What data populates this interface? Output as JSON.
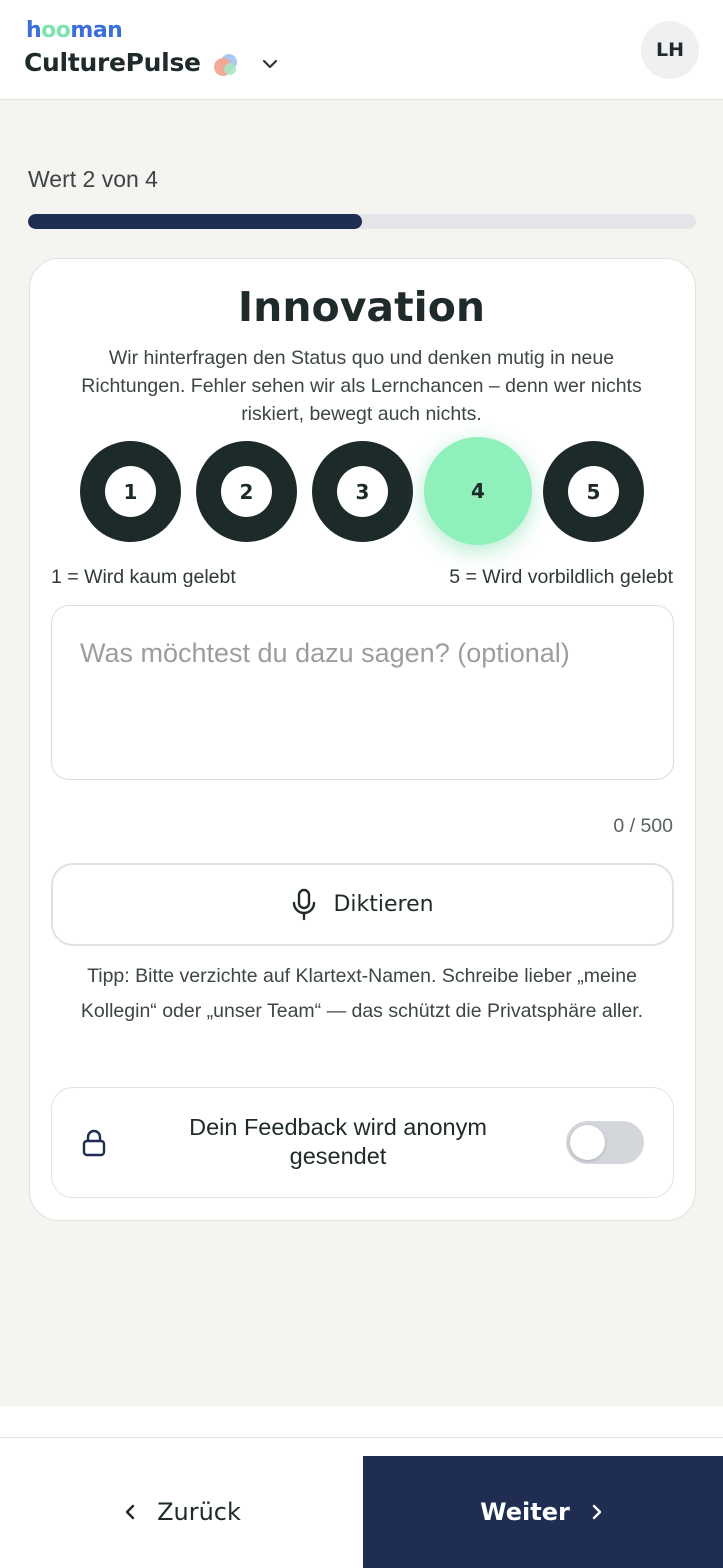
{
  "header": {
    "brand_small_parts": [
      "h",
      "oo",
      "man"
    ],
    "brand_name": "CulturePulse",
    "user_initials": "LH",
    "icons": {
      "logo": "culturepulse-logo-icon",
      "dropdown": "chevron-down-icon"
    }
  },
  "progress": {
    "label": "Wert 2 von 4",
    "current": 2,
    "total": 4,
    "fill_fraction": 0.5
  },
  "value": {
    "title": "Innovation",
    "description": "Wir hinterfragen den Status quo und denken mutig in neue Richtungen. Fehler sehen wir als Lernchancen – denn wer nichts riskiert, bewegt auch nichts."
  },
  "rating": {
    "options": [
      "1",
      "2",
      "3",
      "4",
      "5"
    ],
    "selected": "4",
    "scale_min_label": "1 = Wird kaum gelebt",
    "scale_max_label": "5 = Wird vorbildlich gelebt"
  },
  "comment": {
    "value": "",
    "placeholder": "Was möchtest du dazu sagen? (optional)",
    "counter": "0 / 500"
  },
  "dictate": {
    "label": "Diktieren",
    "icon": "microphone-icon"
  },
  "tip": "Tipp: Bitte verzichte auf Klartext-Namen. Schreibe lieber „meine Kollegin“ oder „unser Team“ — das schützt die Privatsphäre aller.",
  "anonymous": {
    "label": "Dein Feedback wird anonym gesendet",
    "icon": "lock-icon",
    "enabled": false
  },
  "footer": {
    "back_label": "Zurück",
    "next_label": "Weiter",
    "back_icon": "chevron-left-icon",
    "next_icon": "chevron-right-icon"
  },
  "colors": {
    "primary": "#1f2d52",
    "selected_rating": "#8ff0bb",
    "rating_ring": "#1d2a2a",
    "background": "#f5f4f1",
    "brand_blue": "#3b6fd8",
    "brand_mint": "#7ee3b3"
  }
}
